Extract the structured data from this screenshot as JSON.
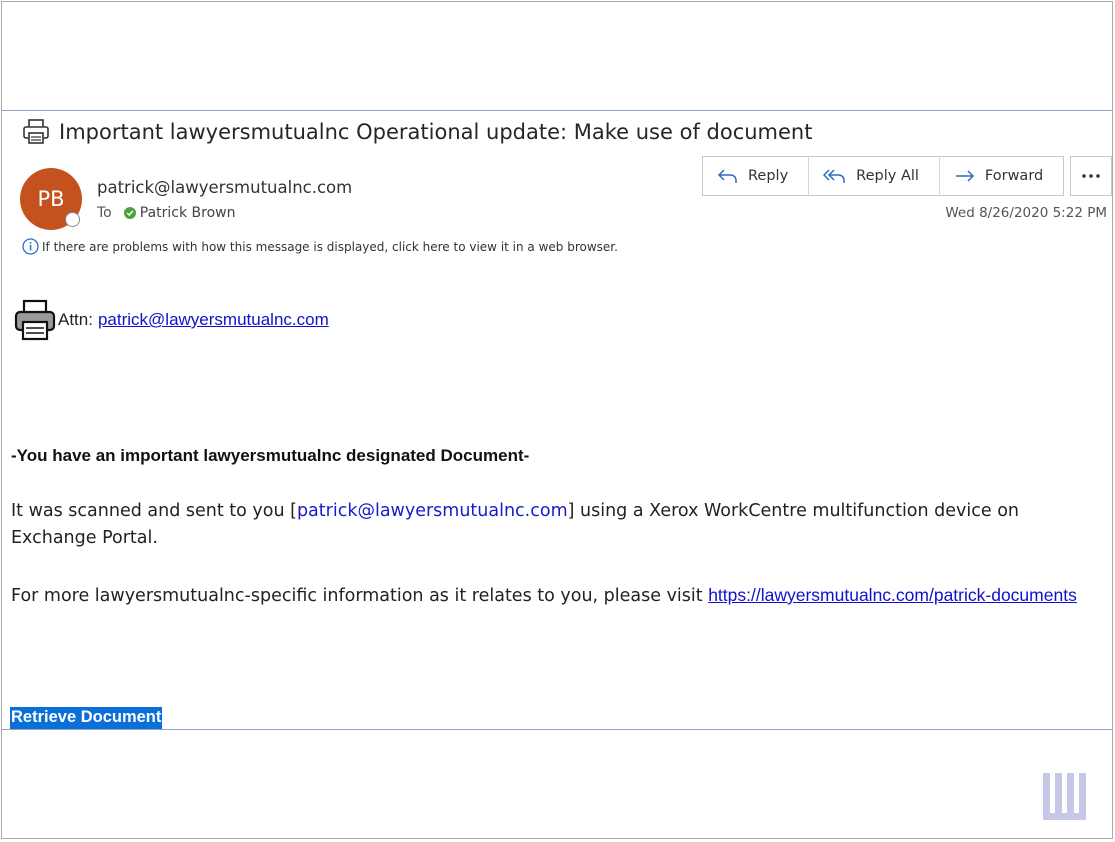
{
  "email": {
    "subject": "Important lawyersmutualnc Operational update: Make use of document",
    "avatar_initials": "PB",
    "sender": "patrick@lawyersmutualnc.com",
    "to_label": "To",
    "recipient": "Patrick Brown",
    "timestamp": "Wed 8/26/2020 5:22 PM",
    "info_text": "If there are problems with how this message is displayed, click here to view it in a web browser.",
    "actions": {
      "reply": "Reply",
      "reply_all": "Reply All",
      "forward": "Forward"
    }
  },
  "body": {
    "attn_label": "Attn:",
    "attn_email": "patrick@lawyersmutualnc.com",
    "heading": "-You have an important lawyersmutualnc designated Document-",
    "para1_pre": "It was scanned and sent to you [",
    "para1_email": "patrick@lawyersmutualnc.com",
    "para1_post": "] using a Xerox WorkCentre multifunction device on Exchange Portal.",
    "para2_pre": "For more lawyersmutualnc-specific information as it relates to you, please visit ",
    "para2_link": "https://lawyersmutualnc.com/patrick-documents",
    "retrieve_label": "Retrieve Document"
  },
  "icons": {
    "subject": "printer-icon",
    "attn": "printer-icon",
    "info": "info-icon",
    "reply": "reply-arrow-icon",
    "reply_all": "reply-all-arrow-icon",
    "forward": "forward-arrow-icon",
    "more": "ellipsis-icon",
    "watermark": "vertical-bars-logo"
  },
  "colors": {
    "avatar": "#c4521f",
    "link": "#1111cc",
    "retrieve_bg": "#0a6fd8",
    "presence_ok": "#4ba43a",
    "action_icon": "#2b6cc4"
  }
}
